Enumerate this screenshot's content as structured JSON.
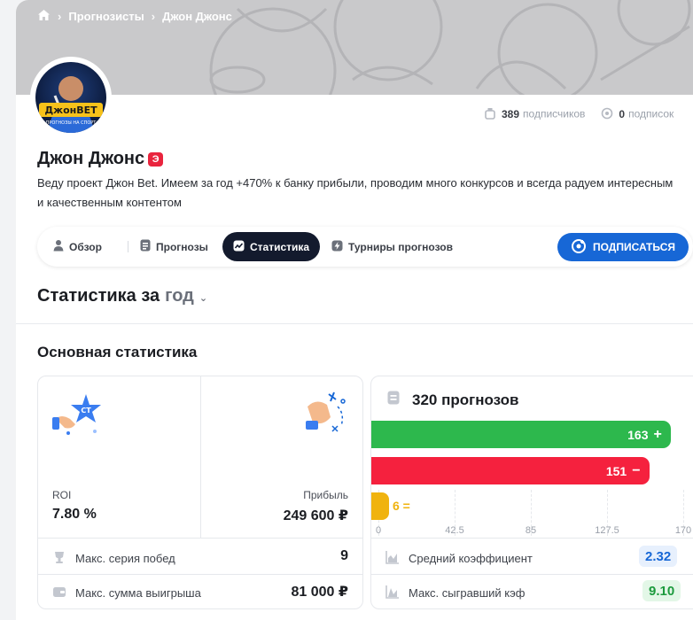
{
  "breadcrumb": {
    "home_icon": "home-icon",
    "items": [
      "Прогнозисты",
      "Джон Джонс"
    ]
  },
  "profile": {
    "name": "Джон Джонс",
    "badge": "Э",
    "description": "Веду проект Джон Bet. Имеем за год +470% к банку прибыли, проводим много конкурсов и всегда радуем интересным и качественным контентом",
    "avatar_text": "ДжонBET",
    "avatar_subtext": "ПРОГНОЗЫ НА СПОРТ"
  },
  "counters": {
    "subscribers_count": "389",
    "subscribers_label": "подписчиков",
    "subscriptions_count": "0",
    "subscriptions_label": "подписок"
  },
  "tabs": [
    {
      "label": "Обзор",
      "icon": "user-icon",
      "active": false
    },
    {
      "label": "Прогнозы",
      "icon": "list-icon",
      "active": false
    },
    {
      "label": "Статистика",
      "icon": "chart-icon",
      "active": true
    },
    {
      "label": "Турниры прогнозов",
      "icon": "lightning-icon",
      "active": false
    }
  ],
  "subscribe_label": "ПОДПИСАТЬСЯ",
  "period": {
    "prefix": "Статистика за",
    "selected": "год"
  },
  "main_stats": {
    "title": "Основная статистика",
    "roi_label": "ROI",
    "roi_value": "7.80 %",
    "profit_label": "Прибыль",
    "profit_value": "249 600 ₽",
    "win_streak_label": "Макс. серия побед",
    "win_streak_value": "9",
    "max_win_label": "Макс. сумма выигрыша",
    "max_win_value": "81 000 ₽"
  },
  "forecasts": {
    "title": "320 прогнозов",
    "wins": 163,
    "losses": 151,
    "ties": 6,
    "wins_symbol": "+",
    "losses_symbol": "−",
    "ties_symbol": "=",
    "axis_ticks": [
      "0",
      "42.5",
      "85",
      "127.5",
      "170"
    ],
    "axis_max": 170,
    "avg_coef_label": "Средний коэффициент",
    "avg_coef_value": "2.32",
    "max_coef_label": "Макс. сыгравший кэф",
    "max_coef_value": "9.10"
  },
  "colors": {
    "win": "#2db84d",
    "loss": "#f5213e",
    "tie": "#f0b30f",
    "accent": "#1767d6",
    "active_tab": "#131a2d"
  }
}
